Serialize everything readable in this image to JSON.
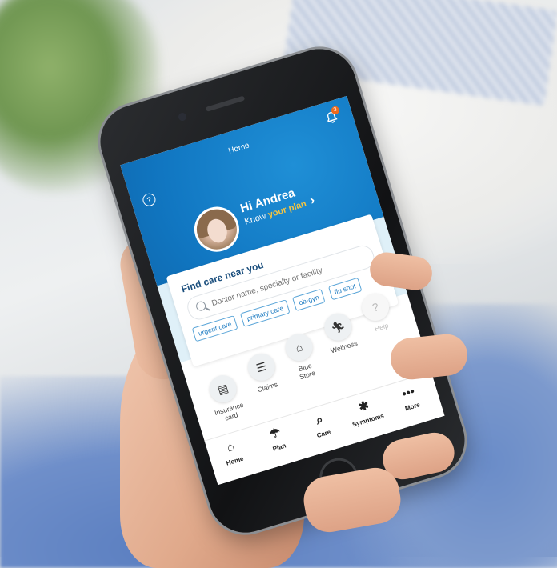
{
  "app": {
    "title": "Home",
    "notification_count": "3"
  },
  "header": {
    "help_icon": "question-circle-icon",
    "greeting": "Hi Andrea",
    "know_prefix": "Know ",
    "know_highlight": "your plan",
    "chevron": "›"
  },
  "find_care": {
    "title": "Find care near you",
    "search_placeholder": "Doctor name, specialty or facility",
    "chips": [
      "urgent care",
      "primary care",
      "ob-gyn",
      "flu shot"
    ]
  },
  "tiles": [
    {
      "label_line1": "Insurance",
      "label_line2": "card",
      "icon": "id-card-icon"
    },
    {
      "label_line1": "Claims",
      "label_line2": "",
      "icon": "document-icon"
    },
    {
      "label_line1": "Blue",
      "label_line2": "Store",
      "icon": "store-icon"
    },
    {
      "label_line1": "Wellness",
      "label_line2": "",
      "icon": "running-person-icon"
    },
    {
      "label_line1": "Help",
      "label_line2": "",
      "icon": "help-icon"
    }
  ],
  "bottom_nav": [
    {
      "label": "Home",
      "icon": "home-icon"
    },
    {
      "label": "Plan",
      "icon": "umbrella-icon"
    },
    {
      "label": "Care",
      "icon": "search-icon"
    },
    {
      "label": "Symptoms",
      "icon": "person-icon"
    },
    {
      "label": "More",
      "icon": "more-icon"
    }
  ],
  "colors": {
    "brand_blue": "#1177c2",
    "highlight_yellow": "#f4c542",
    "badge_orange": "#ee6a1d"
  }
}
